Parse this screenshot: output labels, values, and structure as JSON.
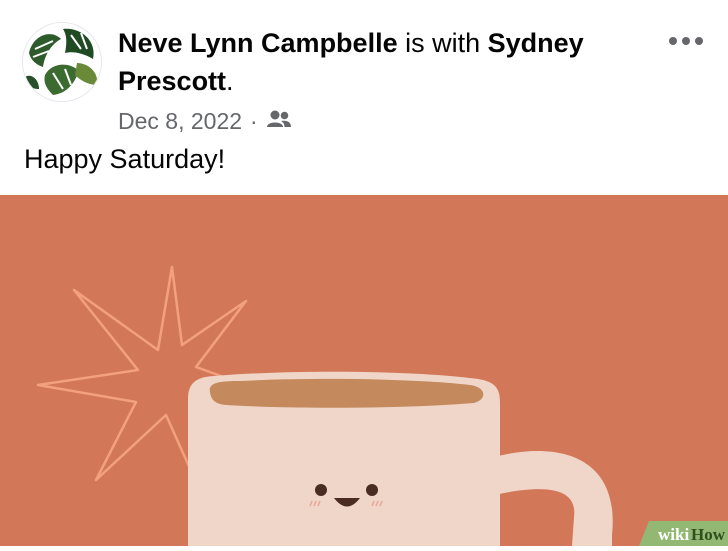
{
  "post": {
    "author": "Neve Lynn Campbelle",
    "with_text": " is with ",
    "tagged": "Sydney Prescott",
    "period": ".",
    "date": "Dec 8, 2022",
    "separator": "·",
    "audience_icon": "friends-icon",
    "more_icon": "more-options-icon",
    "text": "Happy Saturday!"
  },
  "image": {
    "background_color": "#d27859",
    "mug_color": "#f0d6c8",
    "coffee_color": "#c4895c",
    "star_color": "#f2a07e"
  },
  "watermark": {
    "wiki": "wiki",
    "how": "How"
  }
}
